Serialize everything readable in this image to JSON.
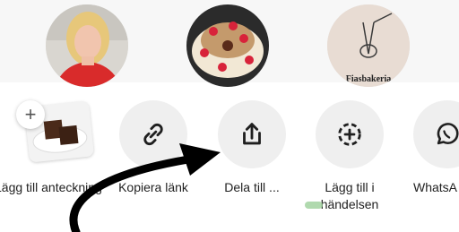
{
  "avatars": [
    {
      "name": "person-avatar"
    },
    {
      "name": "cake-avatar"
    },
    {
      "name": "bakery-avatar",
      "logo_text": "Fiasbakeria"
    }
  ],
  "share_actions": [
    {
      "label": "Lägg till anteckning",
      "icon": "note-with-plus"
    },
    {
      "label": "Kopiera länk",
      "icon": "link-icon"
    },
    {
      "label": "Dela till ...",
      "icon": "share-upload-icon"
    },
    {
      "label_line1": "Lägg till i",
      "label_line2": "händelsen",
      "icon": "add-to-story-icon"
    },
    {
      "label": "WhatsA",
      "icon": "whatsapp-icon"
    }
  ],
  "colors": {
    "button_bg": "#efefef",
    "text": "#1f1f1f",
    "annotation_arrow": "#000000"
  }
}
